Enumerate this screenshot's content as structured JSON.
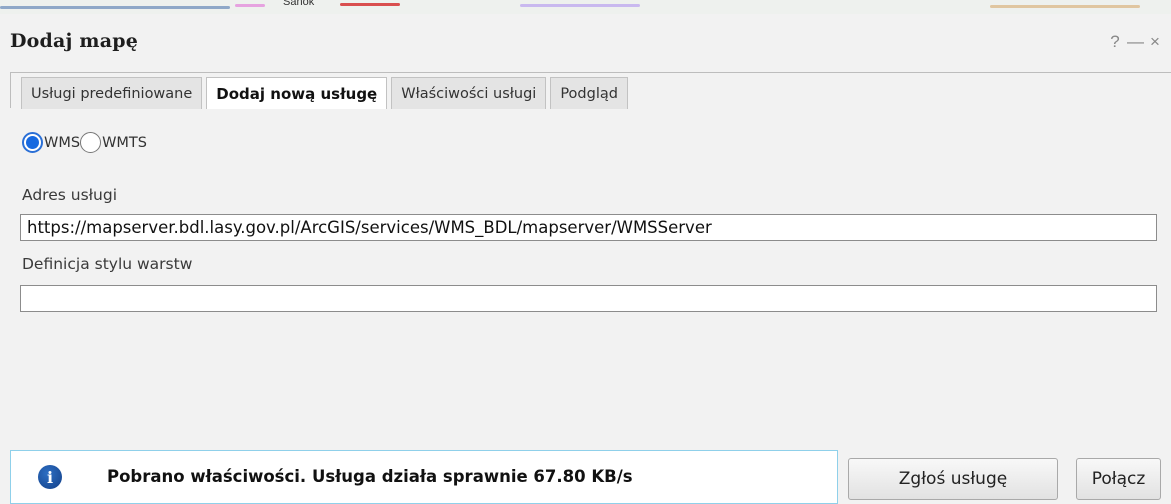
{
  "map_label": "Sanok",
  "window": {
    "title": "Dodaj mapę",
    "controls": [
      "?",
      "—",
      "×"
    ]
  },
  "tabs": [
    {
      "label": "Usługi predefiniowane",
      "active": false
    },
    {
      "label": "Dodaj nową usługę",
      "active": true
    },
    {
      "label": "Właściwości usługi",
      "active": false
    },
    {
      "label": "Podgląd",
      "active": false
    }
  ],
  "service_type": {
    "options": [
      "WMS",
      "WMTS"
    ],
    "selected": "WMS"
  },
  "address": {
    "label": "Adres usługi",
    "value": "https://mapserver.bdl.lasy.gov.pl/ArcGIS/services/WMS_BDL/mapserver/WMSServer"
  },
  "style_definition": {
    "label": "Definicja stylu warstw",
    "value": ""
  },
  "status": {
    "icon": "info-icon",
    "message": "Pobrano właściwości. Usługa działa sprawnie 67.80 KB/s"
  },
  "buttons": {
    "report": "Zgłoś usługę",
    "connect": "Połącz"
  },
  "colors": {
    "accent": "#1769e0",
    "status_border": "#8fd0ea"
  }
}
